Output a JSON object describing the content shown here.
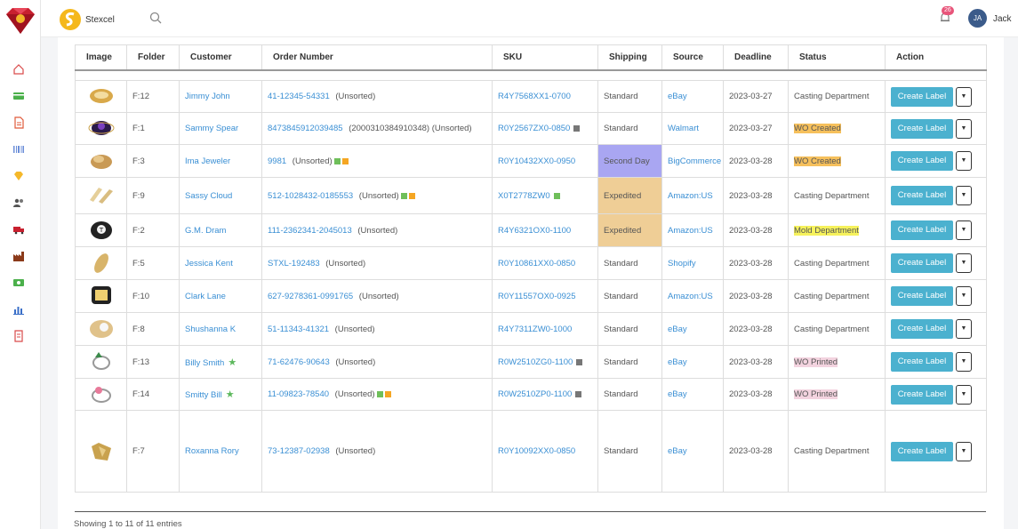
{
  "app": {
    "brand_name": "Stexcel"
  },
  "header": {
    "notification_count": "26",
    "user_initials": "JA",
    "user_name": "Jack"
  },
  "sidebar": {
    "icons": [
      "home-icon",
      "card-icon",
      "document-icon",
      "barcode-icon",
      "gem-icon",
      "users-icon",
      "truck-icon",
      "factory-icon",
      "money-icon",
      "bar-chart-icon",
      "receipt-icon"
    ]
  },
  "table": {
    "columns": [
      "Image",
      "Folder",
      "Customer",
      "Order Number",
      "SKU",
      "Shipping",
      "Source",
      "Deadline",
      "Status",
      "Action"
    ],
    "create_label": "Create Label",
    "rows": [
      {
        "folder": "F:12",
        "customer": "Jimmy John",
        "star": false,
        "order": "41-12345-54331",
        "order_note": "(Unsorted)",
        "marks": [],
        "sku": "R4Y7568XX1-0700",
        "sku_mark": false,
        "shipping": "Standard",
        "shipping_style": "",
        "source": "eBay",
        "deadline": "2023-03-27",
        "status": "Casting Department",
        "status_style": ""
      },
      {
        "folder": "F:1",
        "customer": "Sammy Spear",
        "star": false,
        "order": "8473845912039485",
        "order_note": "(2000310384910348)  (Unsorted)",
        "marks": [],
        "sku": "R0Y2567ZX0-0850",
        "sku_mark": true,
        "shipping": "Standard",
        "shipping_style": "",
        "source": "Walmart",
        "deadline": "2023-03-27",
        "status": "WO Created",
        "status_style": "st-wo-created"
      },
      {
        "folder": "F:3",
        "customer": "Ima Jeweler",
        "star": false,
        "order": "9981",
        "order_note": "(Unsorted)",
        "marks": [
          "green",
          "orange"
        ],
        "sku": "R0Y10432XX0-0950",
        "sku_mark": false,
        "shipping": "Second Day",
        "shipping_style": "ship-second",
        "source": "BigCommerce",
        "deadline": "2023-03-28",
        "status": "WO Created",
        "status_style": "st-wo-created"
      },
      {
        "folder": "F:9",
        "customer": "Sassy Cloud",
        "star": false,
        "order": "512-1028432-0185553",
        "order_note": "(Unsorted)",
        "marks": [
          "green",
          "orange"
        ],
        "sku": "X0T2778ZW0",
        "sku_mark": true,
        "sku_mark_green": true,
        "shipping": "Expedited",
        "shipping_style": "ship-exp",
        "source": "Amazon:US",
        "deadline": "2023-03-28",
        "status": "Casting Department",
        "status_style": ""
      },
      {
        "folder": "F:2",
        "customer": "G.M. Dram",
        "star": false,
        "order": "111-2362341-2045013",
        "order_note": "(Unsorted)",
        "marks": [],
        "sku": "R4Y6321OX0-1100",
        "sku_mark": false,
        "shipping": "Expedited",
        "shipping_style": "ship-exp",
        "source": "Amazon:US",
        "deadline": "2023-03-28",
        "status": "Mold Department",
        "status_style": "st-mold"
      },
      {
        "folder": "F:5",
        "customer": "Jessica Kent",
        "star": false,
        "order": "STXL-192483",
        "order_note": "(Unsorted)",
        "marks": [],
        "sku": "R0Y10861XX0-0850",
        "sku_mark": false,
        "shipping": "Standard",
        "shipping_style": "",
        "source": "Shopify",
        "deadline": "2023-03-28",
        "status": "Casting Department",
        "status_style": ""
      },
      {
        "folder": "F:10",
        "customer": "Clark Lane",
        "star": false,
        "order": "627-9278361-0991765",
        "order_note": "(Unsorted)",
        "marks": [],
        "sku": "R0Y11557OX0-0925",
        "sku_mark": false,
        "shipping": "Standard",
        "shipping_style": "",
        "source": "Amazon:US",
        "deadline": "2023-03-28",
        "status": "Casting Department",
        "status_style": ""
      },
      {
        "folder": "F:8",
        "customer": "Shushanna K",
        "star": false,
        "order": "51-11343-41321",
        "order_note": "(Unsorted)",
        "marks": [],
        "sku": "R4Y7311ZW0-1000",
        "sku_mark": false,
        "shipping": "Standard",
        "shipping_style": "",
        "source": "eBay",
        "deadline": "2023-03-28",
        "status": "Casting Department",
        "status_style": ""
      },
      {
        "folder": "F:13",
        "customer": "Billy Smith",
        "star": true,
        "order": "71-62476-90643",
        "order_note": "(Unsorted)",
        "marks": [],
        "sku": "R0W2510ZG0-1100",
        "sku_mark": true,
        "shipping": "Standard",
        "shipping_style": "",
        "source": "eBay",
        "deadline": "2023-03-28",
        "status": "WO Printed",
        "status_style": "st-printed"
      },
      {
        "folder": "F:14",
        "customer": "Smitty Bill",
        "star": true,
        "order": "11-09823-78540",
        "order_note": "(Unsorted)",
        "marks": [
          "green",
          "orange"
        ],
        "sku": "R0W2510ZP0-1100",
        "sku_mark": true,
        "shipping": "Standard",
        "shipping_style": "",
        "source": "eBay",
        "deadline": "2023-03-28",
        "status": "WO Printed",
        "status_style": "st-printed"
      },
      {
        "folder": "F:7",
        "customer": "Roxanna Rory",
        "star": false,
        "order": "73-12387-02938",
        "order_note": "(Unsorted)",
        "marks": [],
        "sku": "R0Y10092XX0-0850",
        "sku_mark": false,
        "shipping": "Standard",
        "shipping_style": "",
        "source": "eBay",
        "deadline": "2023-03-28",
        "status": "Casting Department",
        "status_style": ""
      }
    ]
  },
  "footer": {
    "entries_text": "Showing 1 to 11 of 11 entries"
  },
  "colors": {
    "link": "#3a8fd4",
    "button": "#4bb1cf",
    "accent_red": "#c8202f"
  }
}
